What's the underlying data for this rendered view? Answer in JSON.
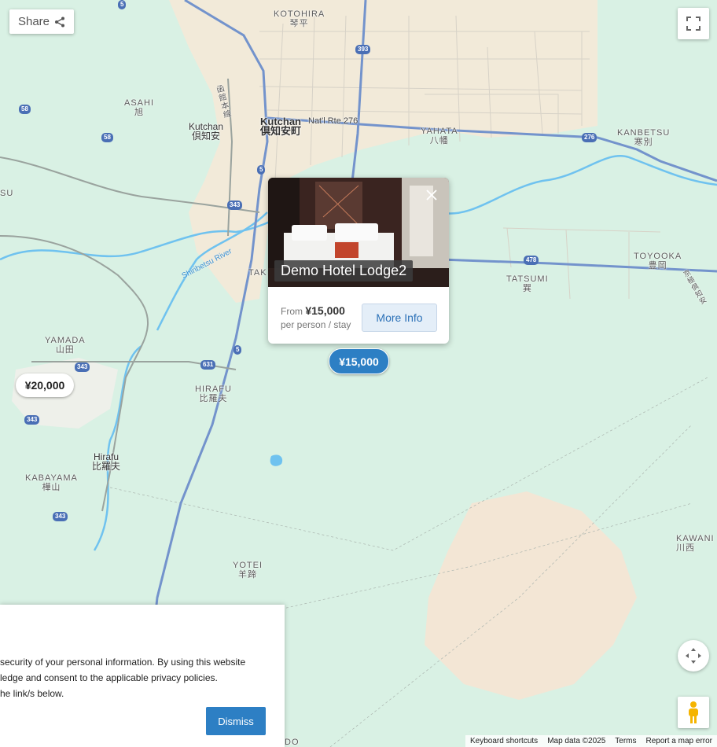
{
  "map": {
    "places": [
      {
        "id": "kotohira",
        "name": "KOTOHIRA",
        "jp": "琴平"
      },
      {
        "id": "asahi",
        "name": "ASAHI",
        "jp": "旭"
      },
      {
        "id": "kutchan-town",
        "name": "Kutchan",
        "jp": "倶知安町"
      },
      {
        "id": "kutchan-station",
        "name": "Kutchan",
        "jp": "倶知安"
      },
      {
        "id": "yahata",
        "name": "YAHATA",
        "jp": "八幡"
      },
      {
        "id": "kanbetsu",
        "name": "KANBETSU",
        "jp": "寒別"
      },
      {
        "id": "toyooka",
        "name": "TOYOOKA",
        "jp": "豊岡"
      },
      {
        "id": "tatsumi",
        "name": "TATSUMI",
        "jp": "巽"
      },
      {
        "id": "yamada",
        "name": "YAMADA",
        "jp": "山田"
      },
      {
        "id": "hirafu-district",
        "name": "HIRAFU",
        "jp": "比羅夫"
      },
      {
        "id": "hirafu-station",
        "name": "Hirafu",
        "jp": "比羅夫"
      },
      {
        "id": "kabayama",
        "name": "KABAYAMA",
        "jp": "樺山"
      },
      {
        "id": "yotei",
        "name": "YOTEI",
        "jp": "羊蹄"
      },
      {
        "id": "kawani",
        "name": "KAWANI",
        "jp": "川西"
      }
    ],
    "partial_labels": {
      "su": "SU",
      "tak": "TAK",
      "do": "DO",
      "hakodate_line": "函館本線",
      "kyogoku_line": "京極倶知安"
    },
    "route_label": "Nat'l Rte 276",
    "river": "Shiribetsu River",
    "shields": [
      "5",
      "393",
      "58",
      "58",
      "276",
      "343",
      "5",
      "478",
      "5",
      "631",
      "343",
      "343",
      "343"
    ]
  },
  "controls": {
    "share_label": "Share",
    "share_icon": "share-icon",
    "fullscreen_icon": "fullscreen-icon",
    "compass_icon": "camera-control-icon",
    "pegman_icon": "pegman-icon"
  },
  "popup": {
    "title": "Demo Hotel Lodge2",
    "price_prefix": "From",
    "price": "¥15,000",
    "price_unit": "per person / stay",
    "button_label": "More Info",
    "close_icon": "close-icon"
  },
  "markers": [
    {
      "label": "¥15,000",
      "selected": true
    },
    {
      "label": "¥20,000",
      "selected": false
    }
  ],
  "cookie_banner": {
    "lines": [
      "security of your personal information. By using this website",
      "ledge and consent to the applicable privacy policies.",
      "he link/s below."
    ],
    "dismiss_label": "Dismiss"
  },
  "attribution": {
    "shortcuts": "Keyboard shortcuts",
    "map_data": "Map data ©2025",
    "terms": "Terms",
    "report": "Report a map error"
  },
  "colors": {
    "accent": "#2d7fc4",
    "land": "#d6f0e3",
    "urban": "#f3ebdd",
    "road": "#6d8dc9",
    "water": "#7cc6ee"
  }
}
